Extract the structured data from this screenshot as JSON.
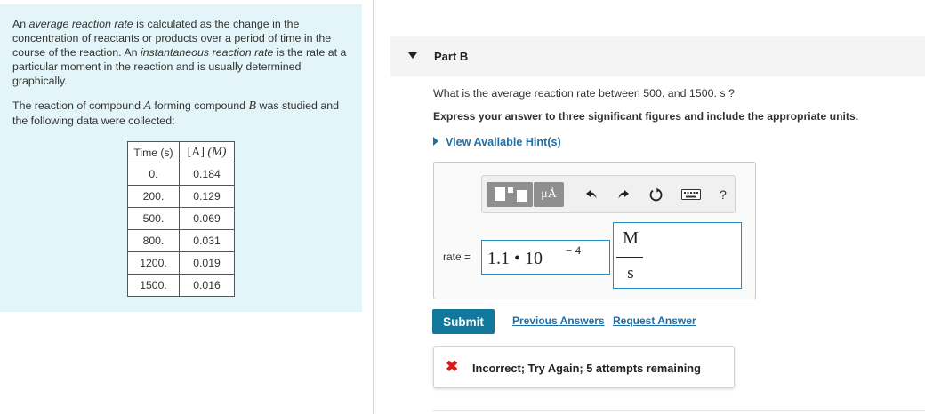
{
  "intro": {
    "p1": [
      {
        "text": "An ",
        "italic": false
      },
      {
        "text": "average reaction rate",
        "italic": true
      },
      {
        "text": " is calculated as the change in the concentration of reactants or products over a period of time in the course of the reaction. An ",
        "italic": false
      },
      {
        "text": "instantaneous reaction rate",
        "italic": true
      },
      {
        "text": " is the rate at a particular moment in the reaction and is usually determined graphically.",
        "italic": false
      }
    ],
    "p2_before": "The reaction of compound ",
    "compound_a": "A",
    "p2_middle": " forming compound ",
    "compound_b": "B",
    "p2_after": " was studied and the following data were collected:"
  },
  "table": {
    "header_time": "Time (s)",
    "header_conc_open": "[A]",
    "header_conc_unit": "(M)",
    "rows": [
      {
        "time": "0.",
        "conc": "0.184"
      },
      {
        "time": "200.",
        "conc": "0.129"
      },
      {
        "time": "500.",
        "conc": "0.069"
      },
      {
        "time": "800.",
        "conc": "0.031"
      },
      {
        "time": "1200.",
        "conc": "0.019"
      },
      {
        "time": "1500.",
        "conc": "0.016"
      }
    ]
  },
  "part": {
    "title": "Part B"
  },
  "question": "What is the average reaction rate between 500. and 1500. s ?",
  "instruction": "Express your answer to three significant figures and include the appropriate units.",
  "hint_label": "View Available Hint(s)",
  "toolbar": {
    "units_label": "μÅ",
    "help_label": "?"
  },
  "answer": {
    "rate_label": "rate =",
    "value_mantissa": "1.1 • 10",
    "value_exponent": "− 4",
    "unit_numerator": "M",
    "unit_denominator": "s"
  },
  "actions": {
    "submit_label": "Submit",
    "previous_label": "Previous Answers",
    "request_label": "Request Answer"
  },
  "feedback": {
    "icon": "✖",
    "text": "Incorrect; Try Again; 5 attempts remaining"
  },
  "colors": {
    "panel_bg": "#e3f5f8",
    "link": "#1f6fa8",
    "submit": "#11779b",
    "error": "#d91a1a",
    "field_border": "#2b8cbf"
  }
}
